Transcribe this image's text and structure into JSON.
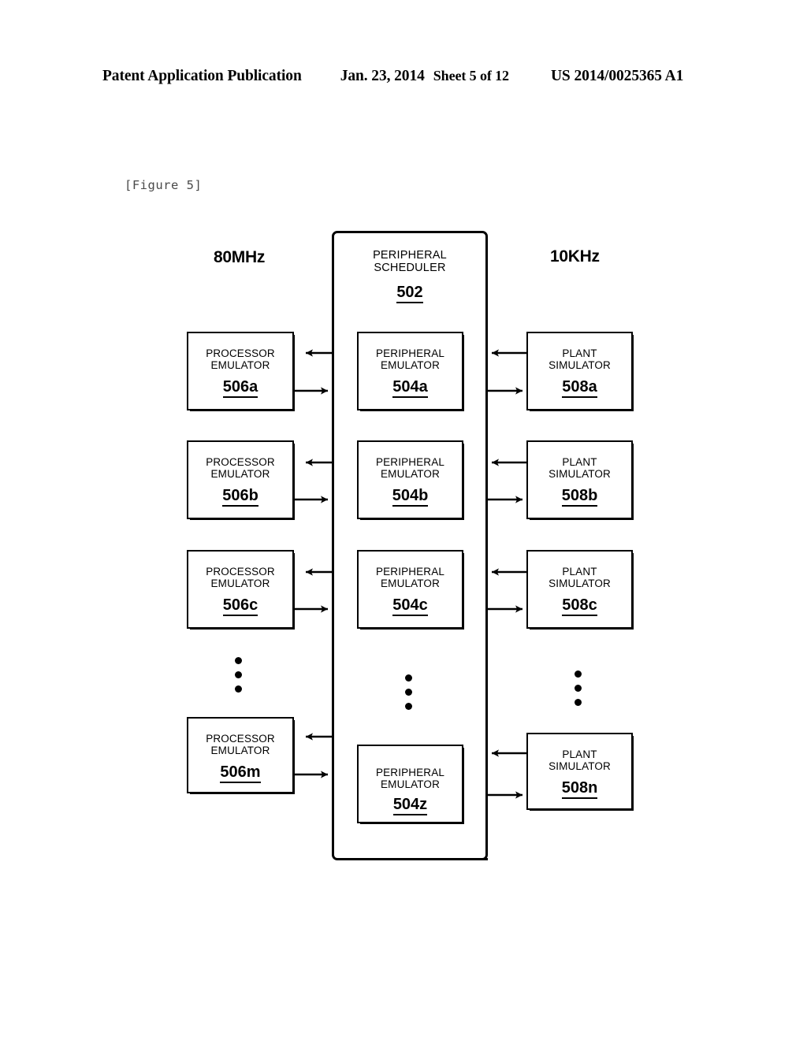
{
  "header": {
    "publication": "Patent Application Publication",
    "date": "Jan. 23, 2014",
    "sheet": "Sheet 5 of 12",
    "patent_number": "US 2014/0025365 A1"
  },
  "figure": {
    "label": "[Figure 5]"
  },
  "diagram": {
    "clocks": {
      "left": "80MHz",
      "right": "10KHz"
    },
    "scheduler": {
      "title": "PERIPHERAL\nSCHEDULER",
      "ref": "502"
    },
    "processor_emulators": [
      {
        "title": "PROCESSOR\nEMULATOR",
        "ref": "506a"
      },
      {
        "title": "PROCESSOR\nEMULATOR",
        "ref": "506b"
      },
      {
        "title": "PROCESSOR\nEMULATOR",
        "ref": "506c"
      },
      {
        "title": "PROCESSOR\nEMULATOR",
        "ref": "506m"
      }
    ],
    "peripheral_emulators": [
      {
        "title": "PERIPHERAL\nEMULATOR",
        "ref": "504a"
      },
      {
        "title": "PERIPHERAL\nEMULATOR",
        "ref": "504b"
      },
      {
        "title": "PERIPHERAL\nEMULATOR",
        "ref": "504c"
      },
      {
        "title": "PERIPHERAL\nEMULATOR",
        "ref": "504z"
      }
    ],
    "plant_simulators": [
      {
        "title": "PLANT\nSIMULATOR",
        "ref": "508a"
      },
      {
        "title": "PLANT\nSIMULATOR",
        "ref": "508b"
      },
      {
        "title": "PLANT\nSIMULATOR",
        "ref": "508c"
      },
      {
        "title": "PLANT\nSIMULATOR",
        "ref": "508n"
      }
    ],
    "ellipsis": {
      "left": "vertical-ellipsis",
      "middle": "vertical-ellipsis",
      "right": "vertical-ellipsis"
    },
    "colors": {
      "ink": "#000000",
      "paper": "#ffffff",
      "caption": "#4a4a4a"
    }
  }
}
